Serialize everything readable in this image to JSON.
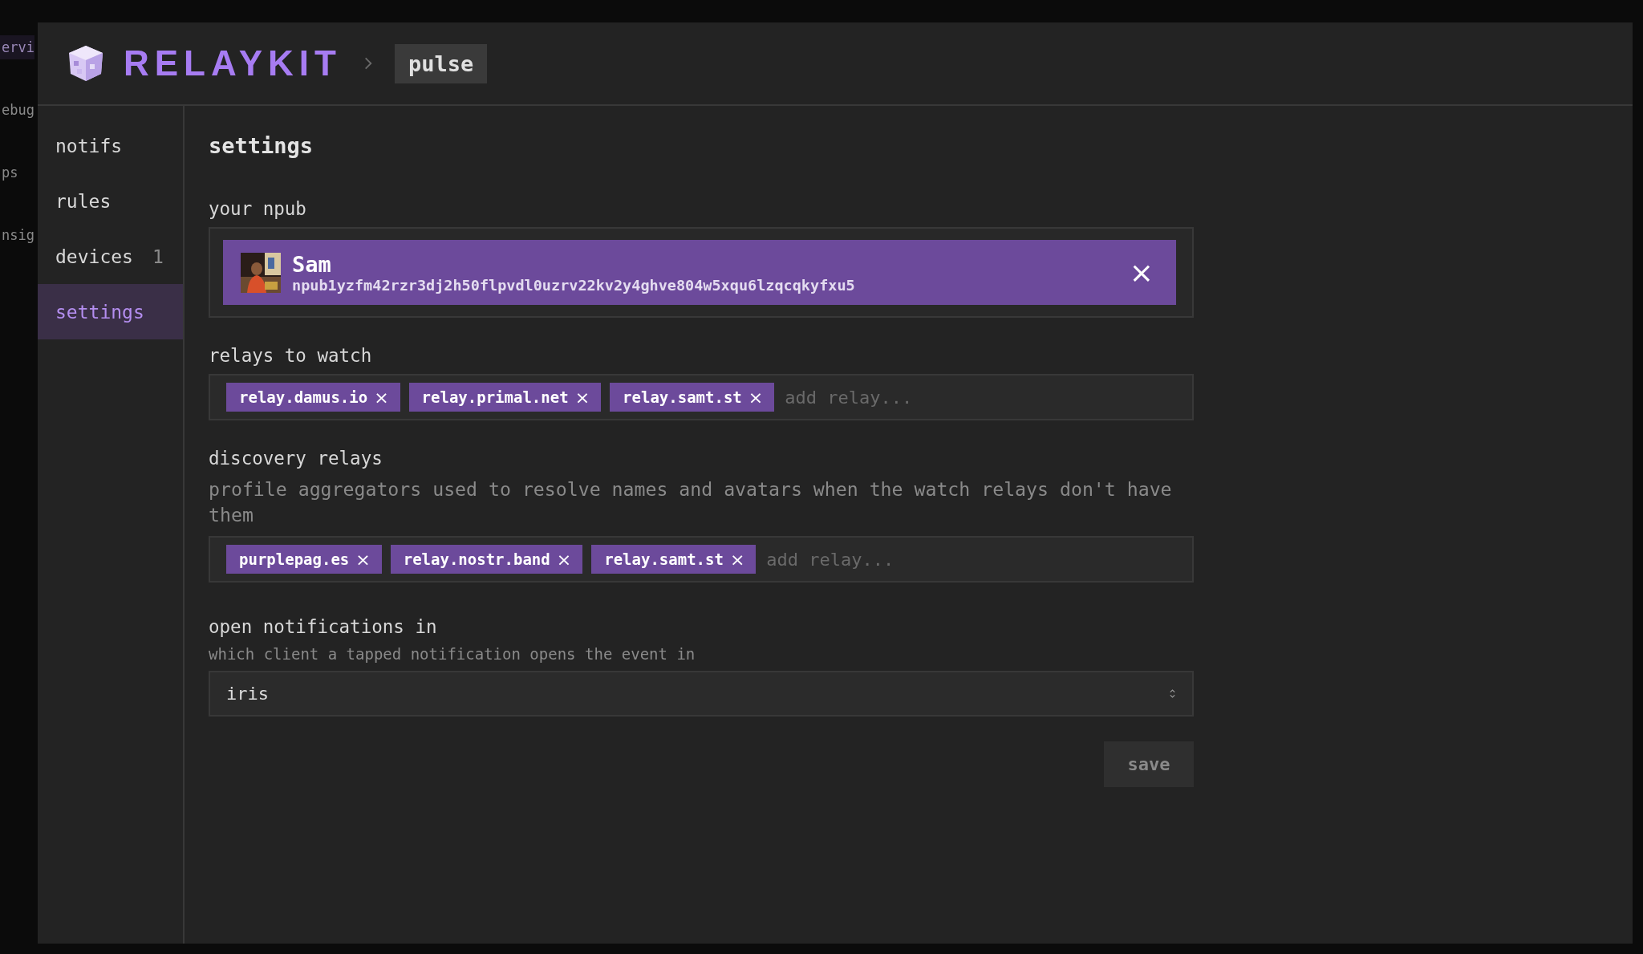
{
  "background_app": {
    "items": [
      {
        "label": "ervi",
        "selected": true
      },
      {
        "label": "ebug",
        "selected": false
      },
      {
        "label": "ps",
        "selected": false
      },
      {
        "label": "nsig",
        "selected": false
      }
    ]
  },
  "header": {
    "brand": "RELAYKIT",
    "breadcrumb": "pulse"
  },
  "sidebar": {
    "items": [
      {
        "label": "notifs",
        "selected": false
      },
      {
        "label": "rules",
        "selected": false
      },
      {
        "label": "devices",
        "count": "1",
        "selected": false
      },
      {
        "label": "settings",
        "selected": true
      }
    ]
  },
  "settings": {
    "title": "settings",
    "npub": {
      "label": "your npub",
      "name": "Sam",
      "npub": "npub1yzfm42rzr3dj2h50flpvdl0uzrv22kv2y4ghve804w5xqu6lzqcqkyfxu5",
      "remove": "×"
    },
    "watch_relays": {
      "label": "relays to watch",
      "relays": [
        {
          "name": "relay.damus.io",
          "remove": "×"
        },
        {
          "name": "relay.primal.net",
          "remove": "×"
        },
        {
          "name": "relay.samt.st",
          "remove": "×"
        }
      ],
      "placeholder": "add relay..."
    },
    "discovery_relays": {
      "label": "discovery relays",
      "description": "profile aggregators used to resolve names and avatars when the watch relays don't have them",
      "relays": [
        {
          "name": "purplepag.es",
          "remove": "×"
        },
        {
          "name": "relay.nostr.band",
          "remove": "×"
        },
        {
          "name": "relay.samt.st",
          "remove": "×"
        }
      ],
      "placeholder": "add relay..."
    },
    "open_in": {
      "label": "open notifications in",
      "hint": "which client a tapped notification opens the event in",
      "value": "iris"
    },
    "save": "save"
  }
}
